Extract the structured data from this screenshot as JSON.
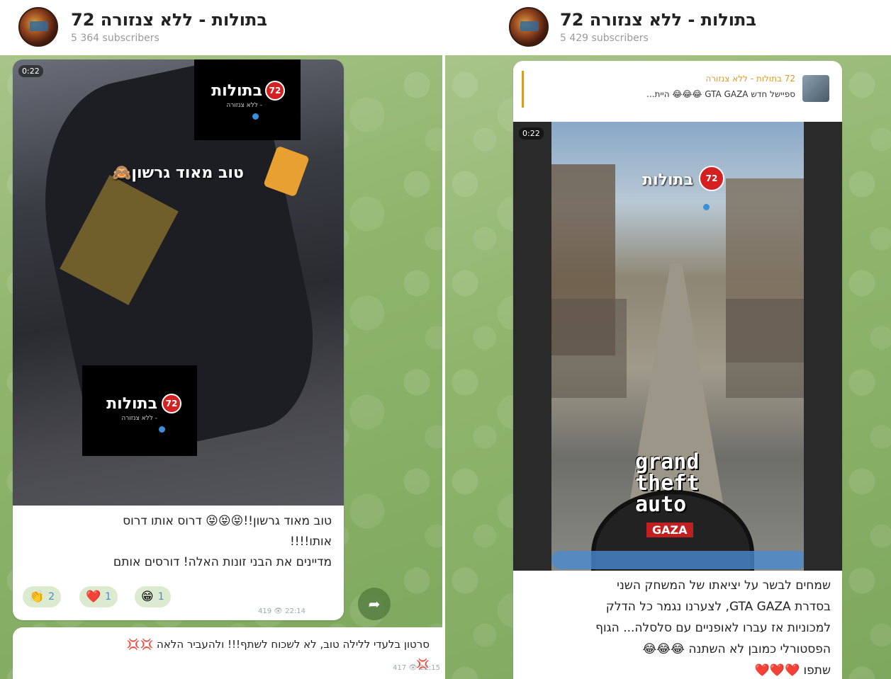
{
  "left": {
    "channel_title": "72 בתולות - ללא צנזורה",
    "subscribers": "5 364 subscribers",
    "video": {
      "duration": "0:22",
      "overlay_caption": "טוב מאוד גרשון🙈",
      "logo_name": "בתולות",
      "logo_sub": "- ללא צנזורה",
      "logo_badge": "72"
    },
    "message_lines": [
      "טוב מאוד גרשון!!😝😝😝 דרוס אותו דרוס",
      "אותו!!!!",
      "מדיינים את הבני זונות האלה! דורסים אותם"
    ],
    "reactions": [
      {
        "emoji": "👏",
        "count": "2"
      },
      {
        "emoji": "❤️",
        "count": "1"
      },
      {
        "emoji": "😁",
        "count": "1"
      }
    ],
    "meta": "419 👁 22:14",
    "share_icon": "share-arrow",
    "next_message_lines": [
      "סרטון בלעדי ללילה טוב, לא לשכוח לשתף!!! ולהעביר הלאה 💢💢",
      "💢"
    ],
    "next_meta": "417 👁 22:15"
  },
  "right": {
    "channel_title": "72 בתולות - ללא צנזורה",
    "subscribers": "5 429 subscribers",
    "quote": {
      "name": "72 בתולות - ללא צנזורה",
      "text": "ספיישל חדש GTA GAZA 😂😂😂 היית..."
    },
    "video": {
      "duration": "0:22",
      "logo_name": "בתולות",
      "logo_badge": "72",
      "gta_lines": [
        "grand",
        "theft",
        "auto"
      ],
      "gta_sub": "GAZA"
    },
    "message_lines": [
      "שמחים לבשר על יציאתו של המשחק השני",
      "בסדרת GTA GAZA, לצערנו נגמר כל הדלק",
      "למכוניות אז עברו לאופניים עם סלסלה... הגוף",
      "הפסטורלי כמובן לא השתנה 😂😂😂",
      "שתפו ❤️❤️❤️"
    ]
  }
}
